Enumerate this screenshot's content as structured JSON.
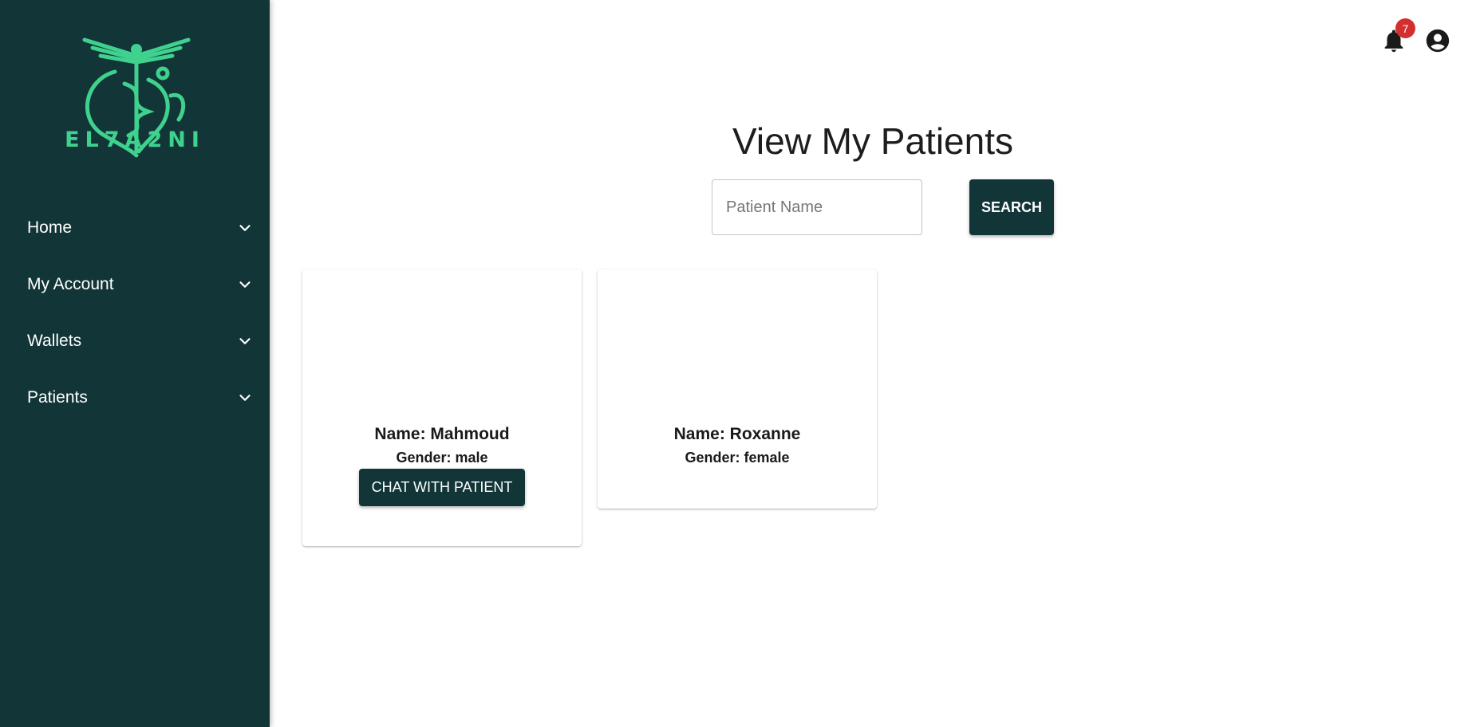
{
  "brand": {
    "name": "EL7A2NI",
    "logo_icon": "caduceus-heart-stethoscope-icon",
    "color": "#3ed28e"
  },
  "theme": {
    "primary": "#123537",
    "badge": "#d32f2f"
  },
  "sidebar": {
    "items": [
      {
        "label": "Home",
        "icon": "chevron-down-icon"
      },
      {
        "label": "My Account",
        "icon": "chevron-down-icon"
      },
      {
        "label": "Wallets",
        "icon": "chevron-down-icon"
      },
      {
        "label": "Patients",
        "icon": "chevron-down-icon"
      }
    ]
  },
  "topbar": {
    "notifications": {
      "icon": "bell-icon",
      "count": "7"
    },
    "account": {
      "icon": "account-circle-icon"
    }
  },
  "main": {
    "title": "View My Patients",
    "search": {
      "placeholder": "Patient Name",
      "value": "",
      "button_label": "SEARCH"
    },
    "patients": [
      {
        "name": "Name: Mahmoud",
        "gender": "Gender: male",
        "chat_label": "CHAT WITH PATIENT"
      },
      {
        "name": "Name: Roxanne",
        "gender": "Gender: female"
      }
    ]
  }
}
